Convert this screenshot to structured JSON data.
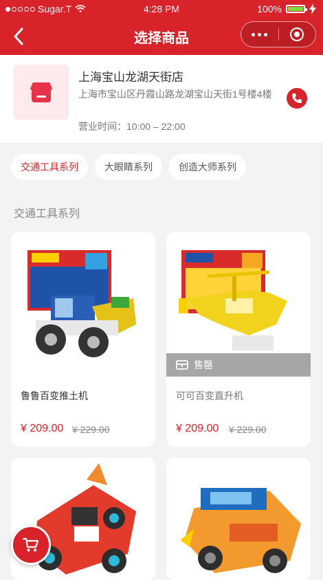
{
  "status_bar": {
    "carrier": "Sugar.T",
    "time": "4:28 PM",
    "battery": "100%"
  },
  "nav": {
    "title": "选择商品"
  },
  "store": {
    "name": "上海宝山龙湖天街店",
    "address": "上海市宝山区丹霞山路龙湖宝山天街1号楼4楼",
    "hours": "营业时间：10:00 – 22:00"
  },
  "tabs": [
    {
      "label": "交通工具系列",
      "active": true
    },
    {
      "label": "大眼睛系列",
      "active": false
    },
    {
      "label": "创造大师系列",
      "active": false
    }
  ],
  "section_title": "交通工具系列",
  "products": [
    {
      "name": "鲁鲁百变推土机",
      "price": "¥ 209.00",
      "original": "¥ 229.00",
      "sold_out": false
    },
    {
      "name": "可可百变直升机",
      "price": "¥ 209.00",
      "original": "¥ 229.00",
      "sold_out": true,
      "sold_out_label": "售罄"
    },
    {
      "name": "",
      "price": "",
      "original": "",
      "sold_out": false
    },
    {
      "name": "",
      "price": "",
      "original": "",
      "sold_out": false
    }
  ],
  "colors": {
    "brand": "#d8232a",
    "background": "#f3f3f3"
  },
  "icons": {
    "back": "chevron-left-icon",
    "more": "more-dots-icon",
    "close_target": "target-icon",
    "store": "store-icon",
    "phone": "phone-icon",
    "cart": "cart-icon"
  }
}
